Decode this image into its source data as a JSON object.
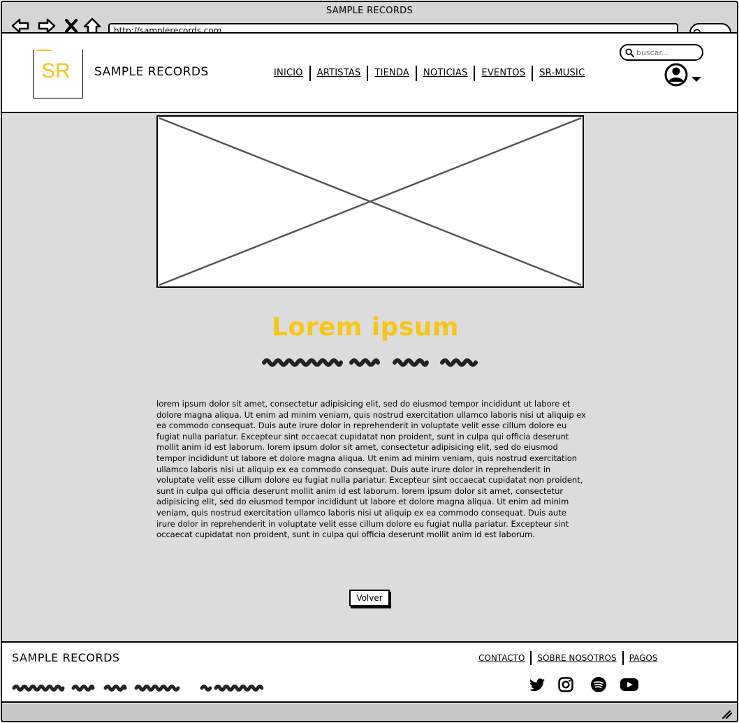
{
  "window": {
    "title": "SAMPLE RECORDS",
    "url": "http://samplerecords.com"
  },
  "header": {
    "logo_text": "SR",
    "brand_name": "SAMPLE RECORDS",
    "nav": [
      "INICIO",
      "ARTISTAS",
      "TIENDA",
      "NOTICIAS",
      "EVENTOS",
      "SR-MUSIC"
    ],
    "search_placeholder": "buscar..."
  },
  "main": {
    "title": "Lorem ipsum",
    "body": "lorem ipsum dolor sit amet, consectetur adipisicing elit, sed do eiusmod tempor incididunt ut labore et dolore magna aliqua. Ut enim ad minim veniam, quis nostrud exercitation ullamco laboris nisi ut aliquip ex ea commodo consequat. Duis aute irure dolor in reprehenderit in voluptate velit esse cillum dolore eu fugiat nulla pariatur. Excepteur sint occaecat cupidatat non proident, sunt in culpa qui officia deserunt mollit anim id est laborum. lorem ipsum dolor sit amet, consectetur adipisicing elit, sed do eiusmod tempor incididunt ut labore et dolore magna aliqua. Ut enim ad minim veniam, quis nostrud exercitation ullamco laboris nisi ut aliquip ex ea commodo consequat. Duis aute irure dolor in reprehenderit in voluptate velit esse cillum dolore eu fugiat nulla pariatur. Excepteur sint occaecat cupidatat non proident, sunt in culpa qui officia deserunt mollit anim id est laborum. lorem ipsum dolor sit amet, consectetur adipisicing elit, sed do eiusmod tempor incididunt ut labore et dolore magna aliqua. Ut enim ad minim veniam, quis nostrud exercitation ullamco laboris nisi ut aliquip ex ea commodo consequat. Duis aute irure dolor in reprehenderit in voluptate velit esse cillum dolore eu fugiat nulla pariatur. Excepteur sint occaecat cupidatat non proident, sunt in culpa qui officia deserunt mollit anim id est laborum.",
    "back_button": "Volver"
  },
  "footer": {
    "brand_name": "SAMPLE RECORDS",
    "links": [
      "CONTACTO",
      "SOBRE NOSOTROS",
      "PAGOS"
    ],
    "social_icons": [
      "twitter-icon",
      "instagram-icon",
      "spotify-icon",
      "youtube-icon"
    ]
  },
  "colors": {
    "accent": "#f5c518",
    "background": "#dcdcdc",
    "ink": "#000000"
  }
}
